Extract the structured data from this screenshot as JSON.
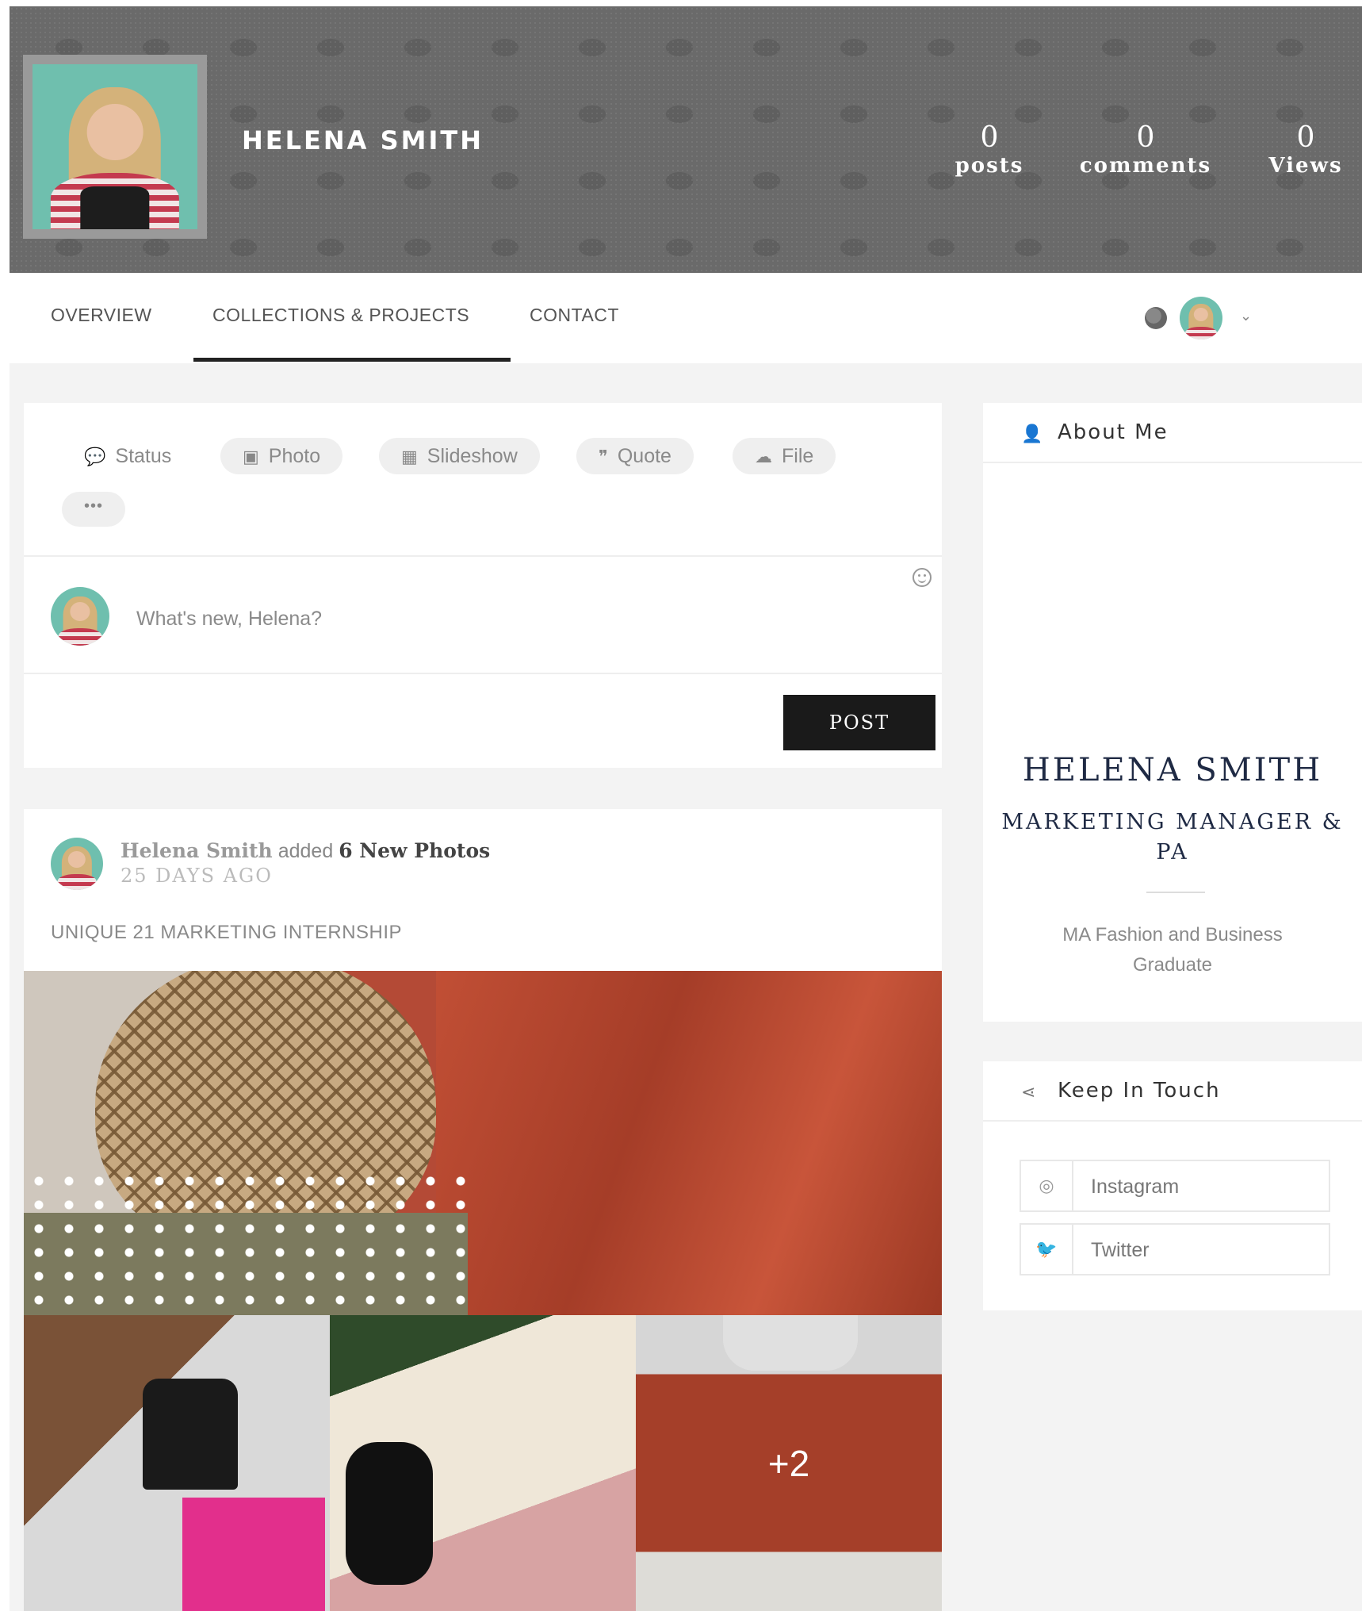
{
  "profile": {
    "name": "HELENA SMITH",
    "stats": [
      {
        "value": "0",
        "label": "posts"
      },
      {
        "value": "0",
        "label": "comments"
      },
      {
        "value": "0",
        "label": "Views"
      }
    ]
  },
  "nav": {
    "tabs": [
      "OVERVIEW",
      "COLLECTIONS & PROJECTS",
      "CONTACT"
    ],
    "active_tab": "COLLECTIONS & PROJECTS"
  },
  "composer": {
    "types": [
      {
        "label": "Status",
        "icon": "speech-bubble-icon"
      },
      {
        "label": "Photo",
        "icon": "image-icon"
      },
      {
        "label": "Slideshow",
        "icon": "film-icon"
      },
      {
        "label": "Quote",
        "icon": "quote-icon"
      },
      {
        "label": "File",
        "icon": "cloud-upload-icon"
      }
    ],
    "more_label": "•••",
    "placeholder": "What's new, Helena?",
    "post_label": "POST"
  },
  "feed": {
    "author": "Helena Smith",
    "verb": "added",
    "object": "6 New Photos",
    "time": "25 DAYS AGO",
    "title": "UNIQUE 21 MARKETING INTERNSHIP",
    "more_photos": "+2"
  },
  "about": {
    "header": "About Me",
    "name": "HELENA SMITH",
    "role": "MARKETING MANAGER & PA",
    "bio": "MA Fashion and Business Graduate"
  },
  "keep_in_touch": {
    "header": "Keep In Touch",
    "links": [
      {
        "label": "Instagram",
        "icon": "instagram-icon"
      },
      {
        "label": "Twitter",
        "icon": "twitter-icon"
      }
    ]
  }
}
